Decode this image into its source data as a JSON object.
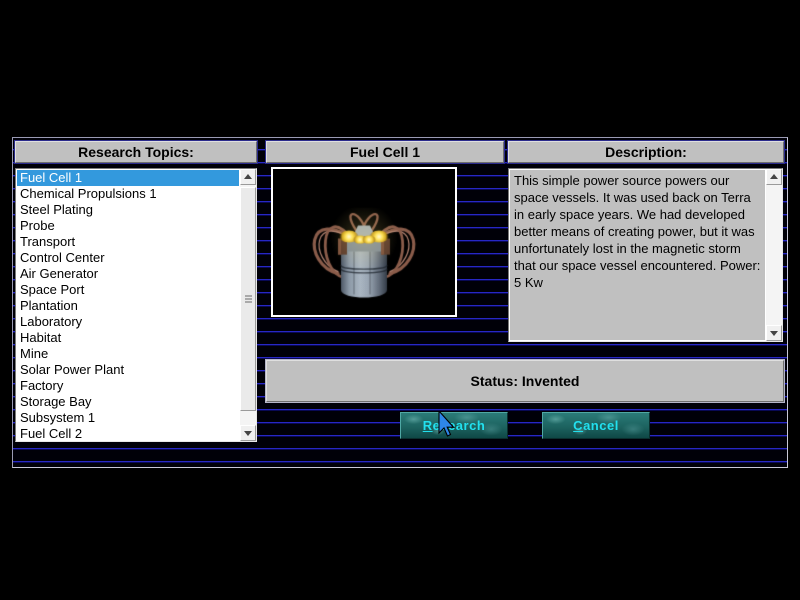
{
  "window": {
    "background_color": "#000000",
    "panel_line_color": "#2828c8"
  },
  "topics_panel": {
    "caption": "Research Topics:",
    "items": [
      "Fuel Cell 1",
      "Chemical Propulsions 1",
      "Steel Plating",
      "Probe",
      "Transport",
      "Control Center",
      "Air Generator",
      "Space Port",
      "Plantation",
      "Laboratory",
      "Habitat",
      "Mine",
      "Solar Power Plant",
      "Factory",
      "Storage Bay",
      "Subsystem 1",
      "Fuel Cell 2"
    ],
    "selected_index": 0,
    "selection_color": "#3399dd",
    "scrollbar": {
      "up_icon": "scroll-up-arrow-icon",
      "down_icon": "scroll-down-arrow-icon"
    }
  },
  "detail_panel": {
    "caption": "Fuel Cell 1",
    "artwork_alt": "fuel-cell-3d-render"
  },
  "description_panel": {
    "caption": "Description:",
    "text": "This simple power source powers our space vessels.  It was used back on Terra in early space years. We had developed better means of creating power, but it was unfortunately lost in the magnetic storm that our space vessel encountered.  Power: 5 Kw",
    "scrollbar": {
      "up_icon": "scroll-up-arrow-icon",
      "down_icon": "scroll-down-arrow-icon"
    }
  },
  "status": {
    "text": "Status: Invented"
  },
  "buttons": {
    "research": {
      "mnemonic": "R",
      "rest": "esearch",
      "color": "#22e0ee"
    },
    "cancel": {
      "mnemonic": "C",
      "rest": "ancel",
      "color": "#22e0ee"
    }
  },
  "cursor": {
    "icon": "mouse-pointer-icon"
  }
}
